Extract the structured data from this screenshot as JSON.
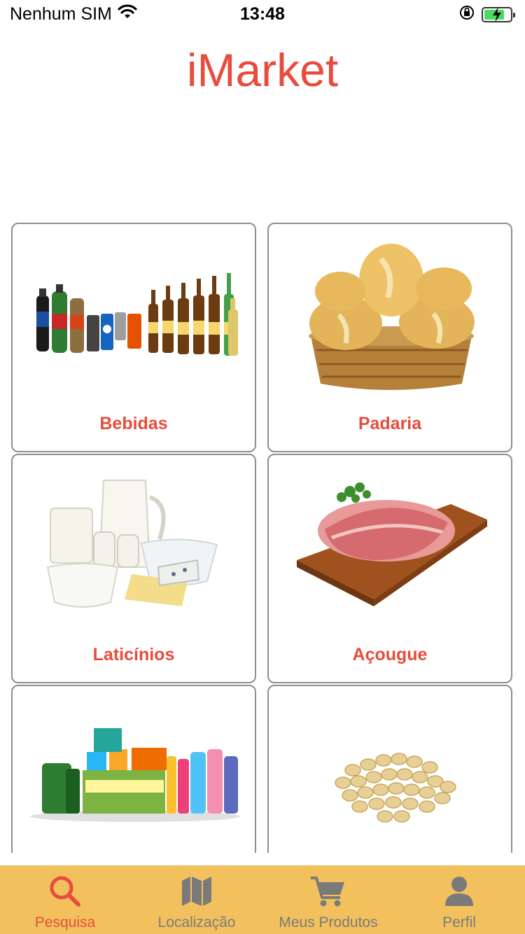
{
  "status_bar": {
    "carrier": "Nenhum SIM",
    "time": "13:48"
  },
  "app": {
    "title": "iMarket",
    "accent_color": "#e74c3c",
    "tabbar_color": "#f2c15e"
  },
  "categories": [
    {
      "label": "Bebidas",
      "image": "drinks-bottles"
    },
    {
      "label": "Padaria",
      "image": "bread-basket"
    },
    {
      "label": "Laticínios",
      "image": "dairy-products"
    },
    {
      "label": "Açougue",
      "image": "meat-cutting-board"
    },
    {
      "label": "",
      "image": "cleaning-products"
    },
    {
      "label": "",
      "image": "peanuts"
    }
  ],
  "tabs": [
    {
      "label": "Pesquisa",
      "icon": "search-icon",
      "active": true
    },
    {
      "label": "Localização",
      "icon": "map-icon",
      "active": false
    },
    {
      "label": "Meus Produtos",
      "icon": "cart-icon",
      "active": false
    },
    {
      "label": "Perfil",
      "icon": "person-icon",
      "active": false
    }
  ]
}
